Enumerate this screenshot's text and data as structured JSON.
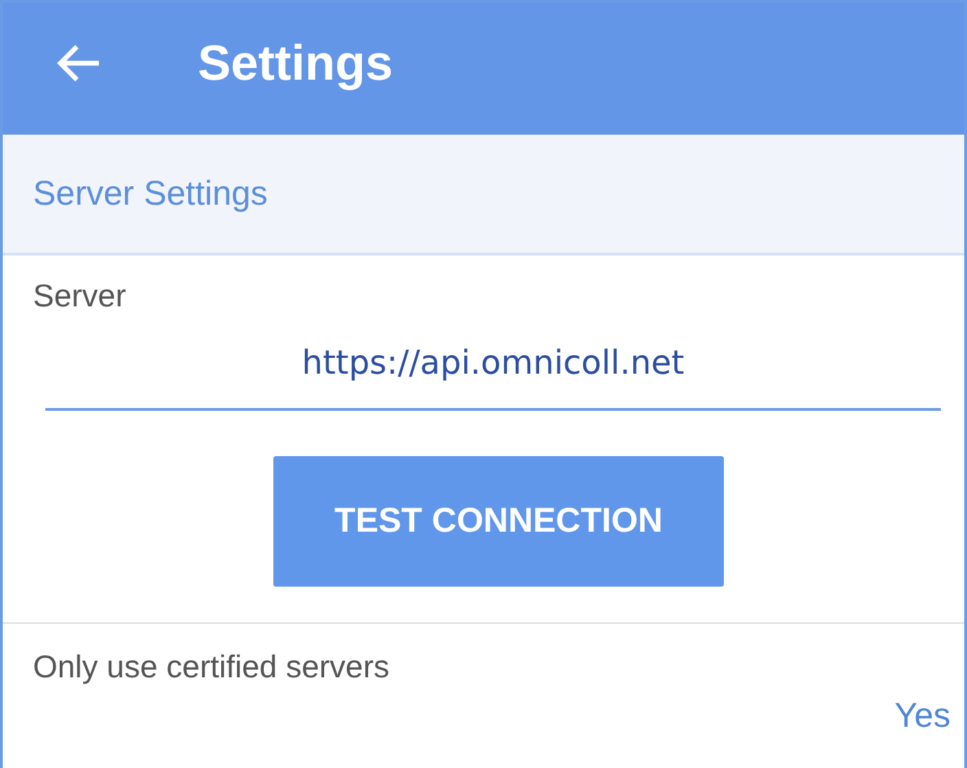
{
  "app_bar": {
    "title": "Settings"
  },
  "section": {
    "title": "Server Settings"
  },
  "server_field": {
    "label": "Server",
    "value": "https://api.omnicoll.net"
  },
  "test_button": {
    "label": "TEST CONNECTION"
  },
  "certified_setting": {
    "label": "Only use certified servers",
    "value": "Yes"
  }
}
